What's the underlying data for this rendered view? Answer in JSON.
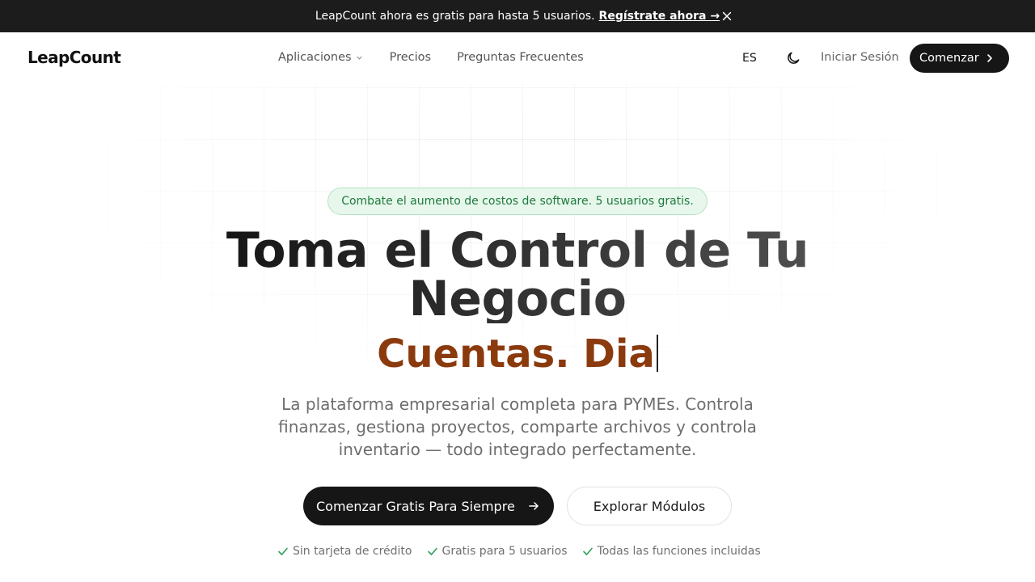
{
  "announcement": {
    "message": "LeapCount ahora es gratis para hasta 5 usuarios.",
    "cta": "Regístrate ahora →"
  },
  "nav": {
    "logo": "LeapCount",
    "links": [
      {
        "label": "Aplicaciones",
        "has_dropdown": true
      },
      {
        "label": "Precios"
      },
      {
        "label": "Preguntas Frecuentes"
      }
    ],
    "language": "ES",
    "login": "Iniciar Sesión",
    "start": "Comenzar"
  },
  "hero": {
    "badge": "Combate el aumento de costos de software. 5 usuarios gratis.",
    "headline_line1": "Toma el Control de Tu",
    "headline_line2": "Negocio",
    "typed_text": "Cuentas. Dia",
    "subtitle": "La plataforma empresarial completa para PYMEs. Controla finanzas, gestiona proyectos, comparte archivos y controla inventario — todo integrado perfectamente.",
    "primary_cta": "Comenzar Gratis Para Siempre",
    "secondary_cta": "Explorar Módulos",
    "checks": [
      "Sin tarjeta de crédito",
      "Gratis para 5 usuarios",
      "Todas las funciones incluidas"
    ]
  },
  "colors": {
    "announcement_bg": "#1c1c1c",
    "primary": "#161616",
    "accent_typed": "#8b3a0e",
    "badge_bg": "#e7f7ec",
    "badge_text": "#1f7a3d",
    "check": "#2e9e5b"
  },
  "icons": {
    "close": "close-icon",
    "dropdown": "chevron-down-icon",
    "theme": "moon-icon",
    "start_chevron": "chevron-right-icon",
    "primary_arrow": "arrow-right-icon",
    "check": "check-icon"
  }
}
